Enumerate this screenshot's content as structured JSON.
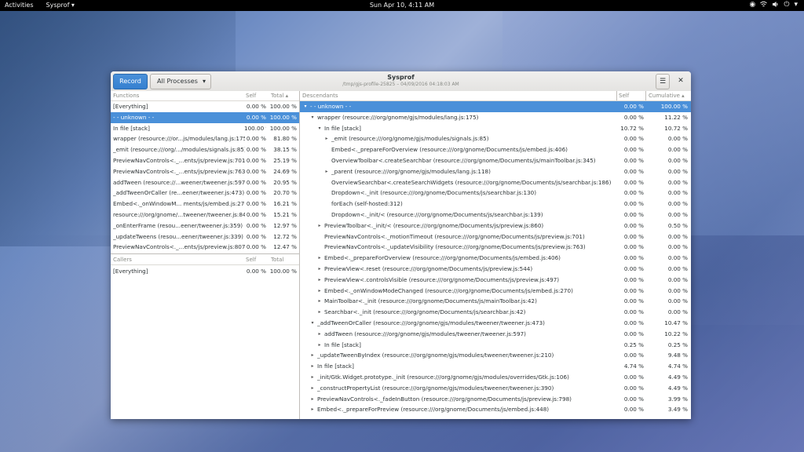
{
  "topbar": {
    "activities": "Activities",
    "app_menu": "Sysprof ▾",
    "clock": "Sun Apr 10,  4:11 AM",
    "status_icons": [
      "◉",
      "⏻"
    ]
  },
  "window": {
    "title": "Sysprof",
    "subtitle": "/tmp/gjs-profile-25825 – 04/09/2016 04:18:03 AM",
    "record_label": "Record",
    "process_label": "All Processes",
    "process_arrow": "▾",
    "menu_icon": "☰",
    "close_icon": "✕"
  },
  "functions": {
    "headers": {
      "name": "Functions",
      "self": "Self",
      "total": "Total ▴"
    },
    "rows": [
      {
        "name": "[Everything]",
        "self": "0.00 %",
        "total": "100.00 %"
      },
      {
        "name": "- - unknown - -",
        "self": "0.00 %",
        "total": "100.00 %",
        "selected": true
      },
      {
        "name": "In file [stack]",
        "self": "100.00 %",
        "total": "100.00 %"
      },
      {
        "name": "wrapper (resource:///or...js/modules/lang.js:175)",
        "self": "0.00 %",
        "total": "81.80 %"
      },
      {
        "name": "_emit (resource:///org/.../modules/signals.js:85)",
        "self": "0.00 %",
        "total": "38.15 %"
      },
      {
        "name": "PreviewNavControls<._...ents/js/preview.js:701)",
        "self": "0.00 %",
        "total": "25.19 %"
      },
      {
        "name": "PreviewNavControls<._...ents/js/preview.js:763)",
        "self": "0.00 %",
        "total": "24.69 %"
      },
      {
        "name": "addTween (resource://...weener/tweener.js:597)",
        "self": "0.00 %",
        "total": "20.95 %"
      },
      {
        "name": "_addTweenOrCaller (re...eener/tweener.js:473)",
        "self": "0.00 %",
        "total": "20.70 %"
      },
      {
        "name": "Embed<._onWindowM... ments/js/embed.js:270)",
        "self": "0.00 %",
        "total": "16.21 %"
      },
      {
        "name": "resource:///org/gnome/...tweener/tweener.js:84",
        "self": "0.00 %",
        "total": "15.21 %"
      },
      {
        "name": "_onEnterFrame (resou...eener/tweener.js:359)",
        "self": "0.00 %",
        "total": "12.97 %"
      },
      {
        "name": "_updateTweens (resou...eener/tweener.js:339)",
        "self": "0.00 %",
        "total": "12.72 %"
      },
      {
        "name": "PreviewNavControls<._...ents/js/preview.js:807)",
        "self": "0.00 %",
        "total": "12.47 %"
      }
    ]
  },
  "callers": {
    "headers": {
      "name": "Callers",
      "self": "Self",
      "total": "Total"
    },
    "rows": [
      {
        "name": "[Everything]",
        "self": "0.00 %",
        "total": "100.00 %"
      }
    ]
  },
  "descendants": {
    "headers": {
      "name": "Descendants",
      "self": "Self",
      "cumulative": "Cumulative ▴"
    },
    "rows": [
      {
        "depth": 0,
        "expander": "▾",
        "name": "- - unknown - -",
        "self": "0.00 %",
        "cum": "100.00 %",
        "selected": true
      },
      {
        "depth": 1,
        "expander": "▾",
        "name": "wrapper (resource:///org/gnome/gjs/modules/lang.js:175)",
        "self": "0.00 %",
        "cum": "11.22 %"
      },
      {
        "depth": 2,
        "expander": "▾",
        "name": "In file [stack]",
        "self": "10.72 %",
        "cum": "10.72 %"
      },
      {
        "depth": 3,
        "expander": "▸",
        "name": "_emit (resource:///org/gnome/gjs/modules/signals.js:85)",
        "self": "0.00 %",
        "cum": "0.00 %"
      },
      {
        "depth": 3,
        "expander": "",
        "name": "Embed<._prepareForOverview (resource:///org/gnome/Documents/js/embed.js:406)",
        "self": "0.00 %",
        "cum": "0.00 %"
      },
      {
        "depth": 3,
        "expander": "",
        "name": "OverviewToolbar<.createSearchbar (resource:///org/gnome/Documents/js/mainToolbar.js:345)",
        "self": "0.00 %",
        "cum": "0.00 %"
      },
      {
        "depth": 3,
        "expander": "▸",
        "name": "_parent (resource:///org/gnome/gjs/modules/lang.js:118)",
        "self": "0.00 %",
        "cum": "0.00 %"
      },
      {
        "depth": 3,
        "expander": "",
        "name": "OverviewSearchbar<.createSearchWidgets (resource:///org/gnome/Documents/js/searchbar.js:186)",
        "self": "0.00 %",
        "cum": "0.00 %"
      },
      {
        "depth": 3,
        "expander": "",
        "name": "Dropdown<._init (resource:///org/gnome/Documents/js/searchbar.js:130)",
        "self": "0.00 %",
        "cum": "0.00 %"
      },
      {
        "depth": 3,
        "expander": "",
        "name": "forEach (self-hosted:312)",
        "self": "0.00 %",
        "cum": "0.00 %"
      },
      {
        "depth": 3,
        "expander": "",
        "name": "Dropdown<._init/< (resource:///org/gnome/Documents/js/searchbar.js:139)",
        "self": "0.00 %",
        "cum": "0.00 %"
      },
      {
        "depth": 2,
        "expander": "▸",
        "name": "PreviewToolbar<._init/< (resource:///org/gnome/Documents/js/preview.js:860)",
        "self": "0.00 %",
        "cum": "0.50 %"
      },
      {
        "depth": 2,
        "expander": "",
        "name": "PreviewNavControls<._motionTimeout (resource:///org/gnome/Documents/js/preview.js:701)",
        "self": "0.00 %",
        "cum": "0.00 %"
      },
      {
        "depth": 2,
        "expander": "",
        "name": "PreviewNavControls<._updateVisibility (resource:///org/gnome/Documents/js/preview.js:763)",
        "self": "0.00 %",
        "cum": "0.00 %"
      },
      {
        "depth": 2,
        "expander": "▸",
        "name": "Embed<._prepareForOverview (resource:///org/gnome/Documents/js/embed.js:406)",
        "self": "0.00 %",
        "cum": "0.00 %"
      },
      {
        "depth": 2,
        "expander": "▸",
        "name": "PreviewView<.reset (resource:///org/gnome/Documents/js/preview.js:544)",
        "self": "0.00 %",
        "cum": "0.00 %"
      },
      {
        "depth": 2,
        "expander": "▸",
        "name": "PreviewView<.controlsVisible (resource:///org/gnome/Documents/js/preview.js:497)",
        "self": "0.00 %",
        "cum": "0.00 %"
      },
      {
        "depth": 2,
        "expander": "▸",
        "name": "Embed<._onWindowModeChanged (resource:///org/gnome/Documents/js/embed.js:270)",
        "self": "0.00 %",
        "cum": "0.00 %"
      },
      {
        "depth": 2,
        "expander": "▸",
        "name": "MainToolbar<._init (resource:///org/gnome/Documents/js/mainToolbar.js:42)",
        "self": "0.00 %",
        "cum": "0.00 %"
      },
      {
        "depth": 2,
        "expander": "▸",
        "name": "Searchbar<._init (resource:///org/gnome/Documents/js/searchbar.js:42)",
        "self": "0.00 %",
        "cum": "0.00 %"
      },
      {
        "depth": 1,
        "expander": "▾",
        "name": "_addTweenOrCaller (resource:///org/gnome/gjs/modules/tweener/tweener.js:473)",
        "self": "0.00 %",
        "cum": "10.47 %"
      },
      {
        "depth": 2,
        "expander": "▸",
        "name": "addTween (resource:///org/gnome/gjs/modules/tweener/tweener.js:597)",
        "self": "0.00 %",
        "cum": "10.22 %"
      },
      {
        "depth": 2,
        "expander": "▸",
        "name": "In file [stack]",
        "self": "0.25 %",
        "cum": "0.25 %"
      },
      {
        "depth": 1,
        "expander": "▸",
        "name": "_updateTweenByIndex (resource:///org/gnome/gjs/modules/tweener/tweener.js:210)",
        "self": "0.00 %",
        "cum": "9.48 %"
      },
      {
        "depth": 1,
        "expander": "▸",
        "name": "In file [stack]",
        "self": "4.74 %",
        "cum": "4.74 %"
      },
      {
        "depth": 1,
        "expander": "▸",
        "name": "_init/Gtk.Widget.prototype._init (resource:///org/gnome/gjs/modules/overrides/Gtk.js:106)",
        "self": "0.00 %",
        "cum": "4.49 %"
      },
      {
        "depth": 1,
        "expander": "▸",
        "name": "_constructPropertyList (resource:///org/gnome/gjs/modules/tweener/tweener.js:390)",
        "self": "0.00 %",
        "cum": "4.49 %"
      },
      {
        "depth": 1,
        "expander": "▸",
        "name": "PreviewNavControls<._fadeInButton (resource:///org/gnome/Documents/js/preview.js:798)",
        "self": "0.00 %",
        "cum": "3.99 %"
      },
      {
        "depth": 1,
        "expander": "▸",
        "name": "Embed<._prepareForPreview (resource:///org/gnome/Documents/js/embed.js:448)",
        "self": "0.00 %",
        "cum": "3.49 %"
      }
    ]
  }
}
